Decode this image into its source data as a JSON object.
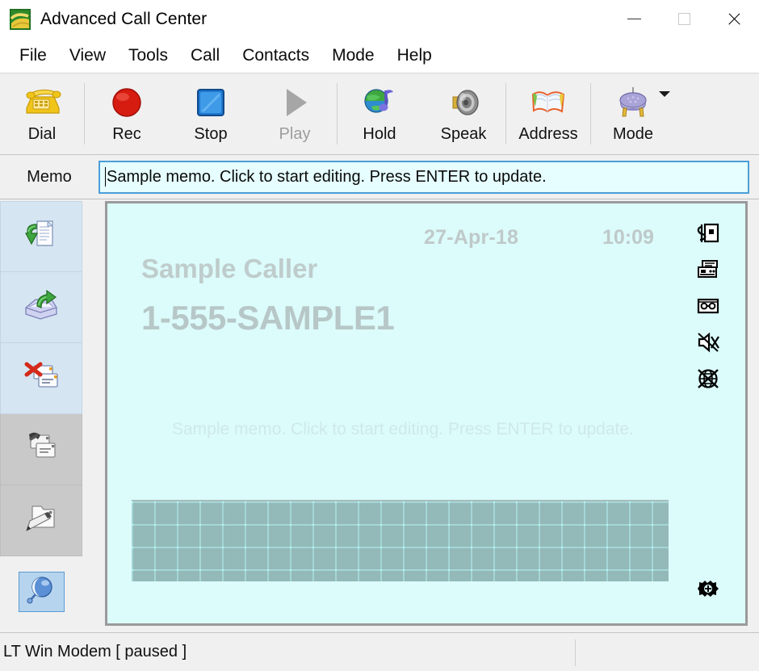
{
  "window": {
    "title": "Advanced Call Center",
    "app_icon": "app-logo-icon",
    "controls": {
      "minimize": "minimize-icon",
      "maximize": "maximize-icon",
      "close": "close-icon"
    }
  },
  "menubar": {
    "items": [
      {
        "label": "File"
      },
      {
        "label": "View"
      },
      {
        "label": "Tools"
      },
      {
        "label": "Call"
      },
      {
        "label": "Contacts"
      },
      {
        "label": "Mode"
      },
      {
        "label": "Help"
      }
    ]
  },
  "toolbar": {
    "buttons": [
      {
        "label": "Dial",
        "icon": "telephone-icon",
        "enabled": true
      },
      {
        "label": "Rec",
        "icon": "record-circle-icon",
        "enabled": true
      },
      {
        "label": "Stop",
        "icon": "stop-square-icon",
        "enabled": true
      },
      {
        "label": "Play",
        "icon": "play-triangle-icon",
        "enabled": false
      },
      {
        "label": "Hold",
        "icon": "globe-music-icon",
        "enabled": true
      },
      {
        "label": "Speak",
        "icon": "speaker-icon",
        "enabled": true
      },
      {
        "label": "Address",
        "icon": "address-book-icon",
        "enabled": true
      },
      {
        "label": "Mode",
        "icon": "modem-plug-icon",
        "enabled": true,
        "has_dropdown": true
      }
    ]
  },
  "memo": {
    "label": "Memo",
    "value": "Sample memo. Click to start editing. Press ENTER to update.",
    "placeholder": "Sample memo. Click to start editing. Press ENTER to update."
  },
  "sidebar": {
    "items": [
      {
        "name": "save-to-file",
        "icon": "document-down-arrow-icon",
        "state": "enabled"
      },
      {
        "name": "export-record",
        "icon": "tray-out-arrow-icon",
        "state": "enabled"
      },
      {
        "name": "delete-record",
        "icon": "cards-red-x-icon",
        "state": "enabled"
      },
      {
        "name": "print-records",
        "icon": "cards-print-icon",
        "state": "disabled"
      },
      {
        "name": "edit-record",
        "icon": "folder-pencil-icon",
        "state": "disabled"
      },
      {
        "name": "call-properties",
        "icon": "blue-balloon-icon",
        "state": "selected"
      }
    ]
  },
  "display": {
    "date": "27-Apr-18",
    "time": "10:09",
    "caller_name": "Sample Caller",
    "caller_number": "1-555-SAMPLE1",
    "memo_text": "Sample memo. Click to start editing. Press ENTER to update.",
    "status_icons": [
      {
        "name": "call-counter-icon"
      },
      {
        "name": "fax-machine-icon"
      },
      {
        "name": "answering-machine-icon"
      },
      {
        "name": "speaker-muted-icon"
      },
      {
        "name": "globe-blocked-icon"
      }
    ],
    "footer_icon": {
      "name": "gear-settings-icon"
    }
  },
  "statusbar": {
    "device_status": "LT Win Modem [ paused ]",
    "right_panel": ""
  },
  "colors": {
    "display_bg": "#dcfbfb",
    "memo_field_bg": "#e6feff",
    "memo_field_border": "#4b9ed8",
    "sidebar_enabled_bg": "#d6e5f2",
    "sidebar_disabled_bg": "#c9c9c9",
    "sidebar_selected_bg": "#b6d4ee",
    "chrome_bg": "#f0f0f0",
    "display_text": "#bfc9c9"
  }
}
